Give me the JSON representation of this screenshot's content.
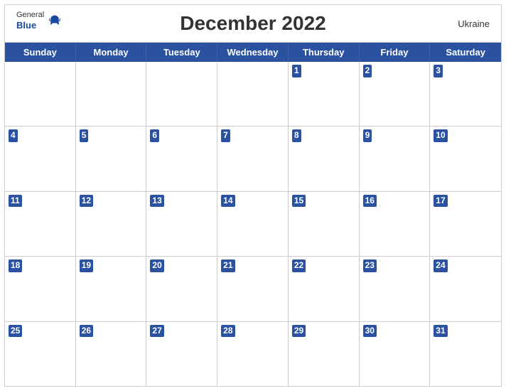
{
  "header": {
    "logo_general": "General",
    "logo_blue": "Blue",
    "title": "December 2022",
    "country": "Ukraine"
  },
  "days_of_week": [
    "Sunday",
    "Monday",
    "Tuesday",
    "Wednesday",
    "Thursday",
    "Friday",
    "Saturday"
  ],
  "weeks": [
    [
      {
        "day": null,
        "empty": true
      },
      {
        "day": null,
        "empty": true
      },
      {
        "day": null,
        "empty": true
      },
      {
        "day": null,
        "empty": true
      },
      {
        "day": 1
      },
      {
        "day": 2
      },
      {
        "day": 3
      }
    ],
    [
      {
        "day": 4
      },
      {
        "day": 5
      },
      {
        "day": 6
      },
      {
        "day": 7
      },
      {
        "day": 8
      },
      {
        "day": 9
      },
      {
        "day": 10
      }
    ],
    [
      {
        "day": 11
      },
      {
        "day": 12
      },
      {
        "day": 13
      },
      {
        "day": 14
      },
      {
        "day": 15
      },
      {
        "day": 16
      },
      {
        "day": 17
      }
    ],
    [
      {
        "day": 18
      },
      {
        "day": 19
      },
      {
        "day": 20
      },
      {
        "day": 21
      },
      {
        "day": 22
      },
      {
        "day": 23
      },
      {
        "day": 24
      }
    ],
    [
      {
        "day": 25
      },
      {
        "day": 26
      },
      {
        "day": 27
      },
      {
        "day": 28
      },
      {
        "day": 29
      },
      {
        "day": 30
      },
      {
        "day": 31
      }
    ]
  ],
  "colors": {
    "header_bg": "#2a52a0",
    "header_text": "#ffffff",
    "cell_bg": "#ffffff",
    "day_num_bg": "#2a52a0",
    "border": "#cccccc"
  }
}
